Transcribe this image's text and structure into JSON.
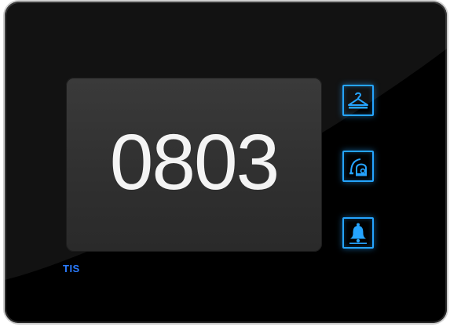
{
  "panel": {
    "room_number": "0803",
    "brand": "TIS"
  },
  "buttons": [
    {
      "icon": "hanger-icon",
      "meaning": "laundry"
    },
    {
      "icon": "vacuum-cleaner-icon",
      "meaning": "make-up-room"
    },
    {
      "icon": "bell-icon",
      "meaning": "doorbell"
    }
  ],
  "colors": {
    "bezel": "#000000",
    "screen": "#333333",
    "digits": "#f4f4f4",
    "button_glow": "#25a4ff",
    "brand": "#2a7bff"
  }
}
